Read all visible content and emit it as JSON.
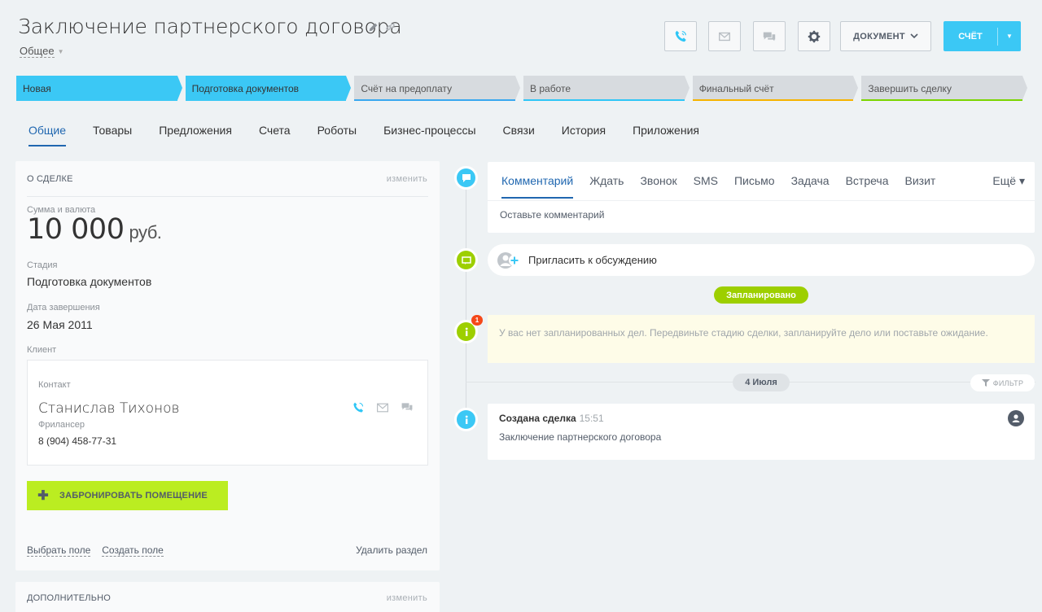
{
  "header": {
    "title": "Заключение партнерского договора",
    "subtitle": "Общее",
    "document_label": "ДОКУМЕНТ",
    "invoice_label": "СЧЁТ"
  },
  "stages": [
    {
      "label": "Новая",
      "state": "active",
      "color": "#3bc8f5"
    },
    {
      "label": "Подготовка документов",
      "state": "active",
      "color": "#3bc8f5"
    },
    {
      "label": "Счёт на предоплату",
      "state": "pending",
      "color": "#39a8ef"
    },
    {
      "label": "В работе",
      "state": "pending",
      "color": "#2fc6f6"
    },
    {
      "label": "Финальный счёт",
      "state": "pending",
      "color": "#f5b300"
    },
    {
      "label": "Завершить сделку",
      "state": "pending",
      "color": "#7bd500"
    }
  ],
  "tabs": [
    "Общие",
    "Товары",
    "Предложения",
    "Счета",
    "Роботы",
    "Бизнес-процессы",
    "Связи",
    "История",
    "Приложения"
  ],
  "about": {
    "heading": "О СДЕЛКЕ",
    "edit": "изменить",
    "amount_label": "Сумма и валюта",
    "amount": "10 000",
    "currency": "руб.",
    "stage_label": "Стадия",
    "stage_value": "Подготовка документов",
    "close_label": "Дата завершения",
    "close_value": "26 Мая 2011",
    "client_label": "Клиент",
    "contact_kind": "Контакт",
    "contact_name": "Станислав Тихонов",
    "contact_role": "Фрилансер",
    "contact_phone": "8 (904) 458-77-31",
    "book_button": "ЗАБРОНИРОВАТЬ ПОМЕЩЕНИЕ",
    "select_field": "Выбрать поле",
    "create_field": "Создать поле",
    "delete_section": "Удалить раздел"
  },
  "extra": {
    "heading": "ДОПОЛНИТЕЛЬНО",
    "edit": "изменить"
  },
  "editor": {
    "tabs": [
      "Комментарий",
      "Ждать",
      "Звонок",
      "SMS",
      "Письмо",
      "Задача",
      "Встреча",
      "Визит"
    ],
    "more": "Ещё",
    "placeholder": "Оставьте комментарий"
  },
  "timeline": {
    "invite": "Пригласить к обсуждению",
    "planned_badge": "Запланировано",
    "counter": "1",
    "notice": "У вас нет запланированных дел. Передвиньте стадию сделки, запланируйте дело или поставьте ожидание.",
    "date_badge": "4 Июля",
    "filter": "ФИЛЬТР",
    "event_title": "Создана сделка",
    "event_time": "15:51",
    "event_text": "Заключение партнерского договора"
  },
  "colors": {
    "accent": "#3bc8f5",
    "green": "#bbed21",
    "badge_green": "#9dcf00",
    "link_blue": "#2067b0"
  }
}
